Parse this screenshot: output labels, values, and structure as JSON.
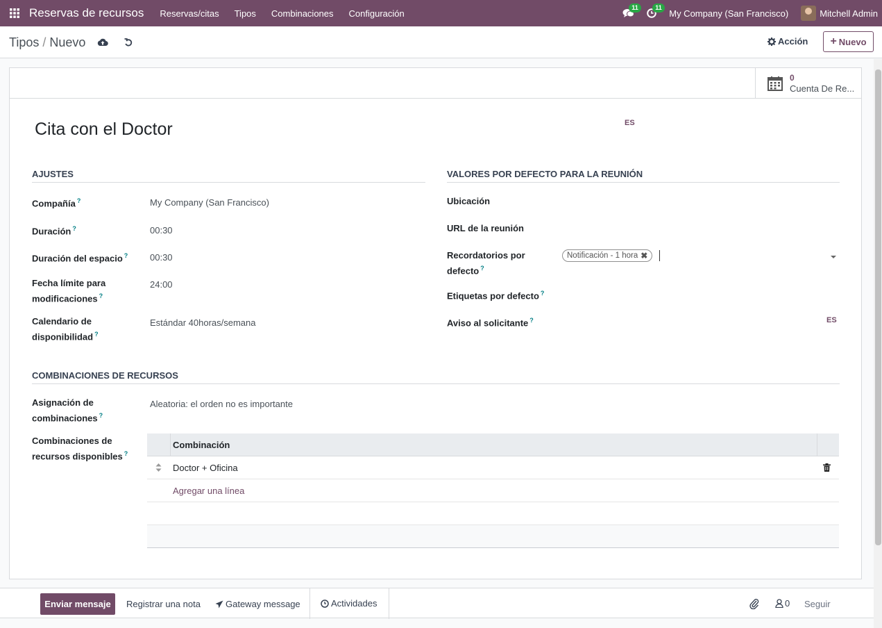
{
  "navbar": {
    "app_name": "Reservas de recursos",
    "menu": [
      "Reservas/citas",
      "Tipos",
      "Combinaciones",
      "Configuración"
    ],
    "messages_count": "11",
    "activities_count": "11",
    "company": "My Company (San Francisco)",
    "user": "Mitchell Admin"
  },
  "control_panel": {
    "breadcrumb_parent": "Tipos",
    "breadcrumb_current": "Nuevo",
    "action_label": "Acción",
    "new_label": "Nuevo"
  },
  "stat_button": {
    "value": "0",
    "label": "Cuenta De Re..."
  },
  "form": {
    "title": "Cita con el Doctor",
    "lang": "ES",
    "settings": {
      "heading": "AJUSTES",
      "company_label": "Compañía",
      "company_value": "My Company (San Francisco)",
      "duration_label": "Duración",
      "duration_value": "00:30",
      "slot_duration_label": "Duración del espacio",
      "slot_duration_value": "00:30",
      "deadline_label_1": "Fecha límite para",
      "deadline_label_2": "modificaciones",
      "deadline_value": "24:00",
      "calendar_label_1": "Calendario de",
      "calendar_label_2": "disponibilidad",
      "calendar_value": "Estándar 40horas/semana"
    },
    "meeting_defaults": {
      "heading": "VALORES POR DEFECTO PARA LA REUNIÓN",
      "location_label": "Ubicación",
      "url_label": "URL de la reunión",
      "reminders_label_1": "Recordatorios por",
      "reminders_label_2": "defecto",
      "reminder_tag": "Notificación - 1 hora",
      "tags_label": "Etiquetas por defecto",
      "notice_label": "Aviso al solicitante",
      "notice_lang": "ES"
    },
    "combinations": {
      "heading": "COMBINACIONES DE RECURSOS",
      "assignment_label_1": "Asignación de",
      "assignment_label_2": "combinaciones",
      "assignment_value": "Aleatoria: el orden no es importante",
      "available_label_1": "Combinaciones de",
      "available_label_2": "recursos disponibles",
      "table_header": "Combinación",
      "rows": [
        "Doctor + Oficina"
      ],
      "add_line": "Agregar una línea"
    }
  },
  "chatter": {
    "send_message": "Enviar mensaje",
    "log_note": "Registrar una nota",
    "gateway": "Gateway message",
    "activities": "Actividades",
    "followers_count": "0",
    "follow": "Seguir"
  }
}
